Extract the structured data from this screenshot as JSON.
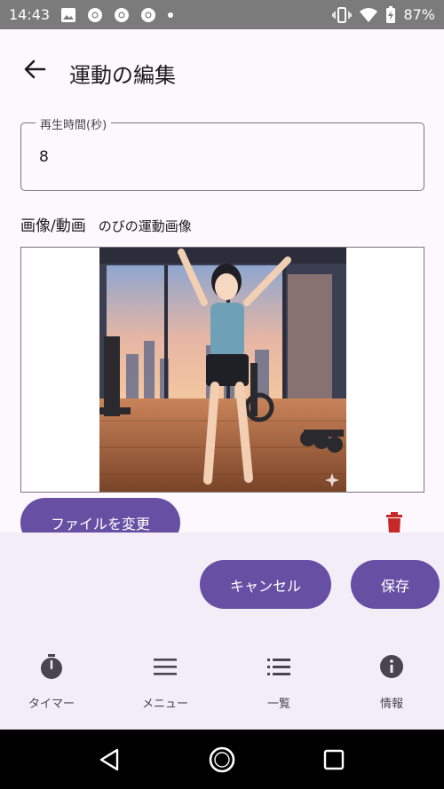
{
  "status_bar": {
    "time": "14:43",
    "battery": "87%",
    "icons": [
      "image-icon",
      "chrome-icon",
      "chrome-icon",
      "chrome-icon",
      "dot-icon",
      "vibrate-icon",
      "wifi-icon",
      "battery-icon"
    ]
  },
  "header": {
    "title": "運動の編集",
    "back_icon": "arrow-back-icon"
  },
  "form": {
    "duration": {
      "label": "再生時間(秒)",
      "value": "8"
    },
    "media": {
      "label": "画像/動画",
      "file_name": "のびの運動画像"
    },
    "change_file_label": "ファイルを変更",
    "delete_icon": "trash-icon"
  },
  "actions": {
    "cancel_label": "キャンセル",
    "save_label": "保存"
  },
  "bottom_nav": {
    "items": [
      {
        "label": "タイマー",
        "icon": "stopwatch-icon"
      },
      {
        "label": "メニュー",
        "icon": "menu-icon"
      },
      {
        "label": "一覧",
        "icon": "list-icon"
      },
      {
        "label": "情報",
        "icon": "info-icon"
      }
    ]
  },
  "colors": {
    "primary": "#6750a4",
    "background": "#fdf7fe",
    "surface_container": "#f3edf7",
    "delete": "#c62828"
  }
}
